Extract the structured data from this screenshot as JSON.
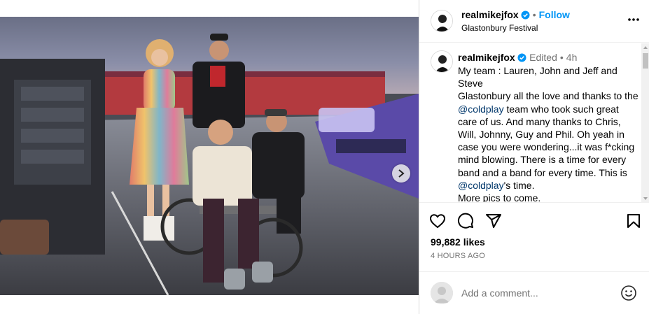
{
  "post": {
    "username": "realmikejfox",
    "follow_label": "Follow",
    "location": "Glastonbury Festival",
    "bullet": "•"
  },
  "caption": {
    "username": "realmikejfox",
    "edited": "Edited",
    "bullet": "•",
    "age": "4h",
    "segments": [
      {
        "text": "My team : Lauren, John and Jeff and Steve\nGlastonbury all the love and thanks to the ",
        "type": "text"
      },
      {
        "text": "@coldplay",
        "type": "mention"
      },
      {
        "text": " team who took such great care of us. And many thanks to Chris, Will, Johnny, Guy and Phil. Oh yeah in case you were wondering...it was f*cking mind blowing. There is a time for every band and a band for every time. This is ",
        "type": "text"
      },
      {
        "text": "@coldplay",
        "type": "mention"
      },
      {
        "text": "'s time.\nMore pics to come.",
        "type": "text"
      }
    ]
  },
  "engagement": {
    "likes": "99,882 likes",
    "time": "4 HOURS AGO"
  },
  "comment": {
    "placeholder": "Add a comment..."
  },
  "carousel": {
    "dots": 4,
    "active_dot": 0
  },
  "icons": {
    "verified": "verified-badge-icon",
    "more": "more-options-icon",
    "like": "heart-icon",
    "comment": "comment-icon",
    "share": "share-icon",
    "save": "bookmark-icon",
    "emoji": "emoji-icon",
    "next": "chevron-right-icon"
  },
  "colors": {
    "accent": "#0095f6",
    "verified": "#0095f6",
    "mention": "#00376b",
    "muted": "#737373"
  }
}
